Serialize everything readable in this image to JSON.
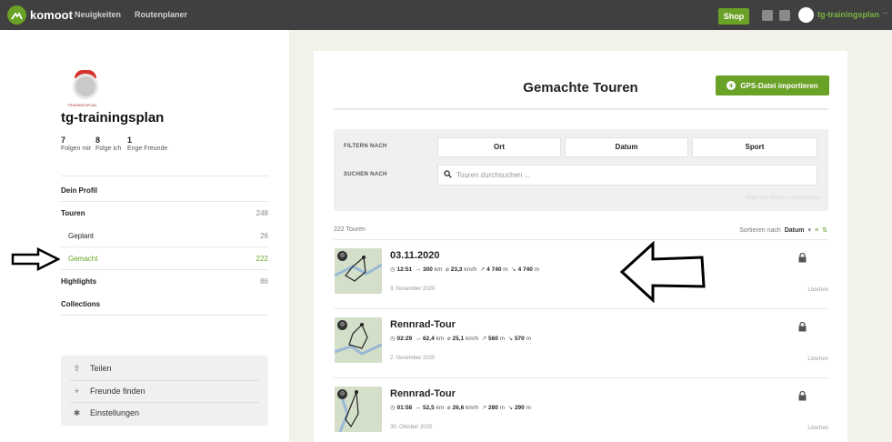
{
  "topbar": {
    "logo_text": "komoot",
    "nav": [
      "Neuigkeiten",
      "Routenplaner"
    ],
    "shop_label": "Shop",
    "username": "tg-trainingsplan",
    "more": "··"
  },
  "sidebar": {
    "logo_text": "TRAININGSPLAN",
    "profile_name": "tg-trainingsplan",
    "stats": [
      {
        "value": "7",
        "label": "Folgen mir"
      },
      {
        "value": "8",
        "label": "Folge ich"
      },
      {
        "value": "1",
        "label": "Enge Freunde"
      }
    ],
    "menu": {
      "profile": "Dein Profil",
      "tours": "Touren",
      "tours_count": "248",
      "planned": "Geplant",
      "planned_count": "26",
      "done": "Gemacht",
      "done_count": "222",
      "highlights": "Highlights",
      "highlights_count": "86",
      "collections": "Collections"
    },
    "actions": [
      "Teilen",
      "Freunde finden",
      "Einstellungen"
    ]
  },
  "main": {
    "title": "Gemachte Touren",
    "gps_button": "GPS-Datei importieren",
    "filter_label": "FILTERN NACH",
    "search_label": "SUCHEN NACH",
    "filters": [
      "Ort",
      "Datum",
      "Sport"
    ],
    "search_placeholder": "Touren durchsuchen ...",
    "filter_reset": "Filter und Suche zurücksetzen",
    "count": "222 Touren",
    "sort_prefix": "Sortieren nach",
    "sort_value": "Datum",
    "tours": [
      {
        "title": "03.11.2020",
        "time": "12:51",
        "distance": "300",
        "speed": "23,3",
        "up": "4 740",
        "down": "4 740",
        "date": "3. November 2020",
        "delete": "Löschen"
      },
      {
        "title": "Rennrad-Tour",
        "time": "02:29",
        "distance": "62,4",
        "speed": "25,1",
        "up": "560",
        "down": "570",
        "date": "2. November 2020",
        "delete": "Löschen"
      },
      {
        "title": "Rennrad-Tour",
        "time": "01:58",
        "distance": "52,5",
        "speed": "26,6",
        "up": "280",
        "down": "290",
        "date": "30. Oktober 2020",
        "delete": "Löschen"
      }
    ]
  }
}
